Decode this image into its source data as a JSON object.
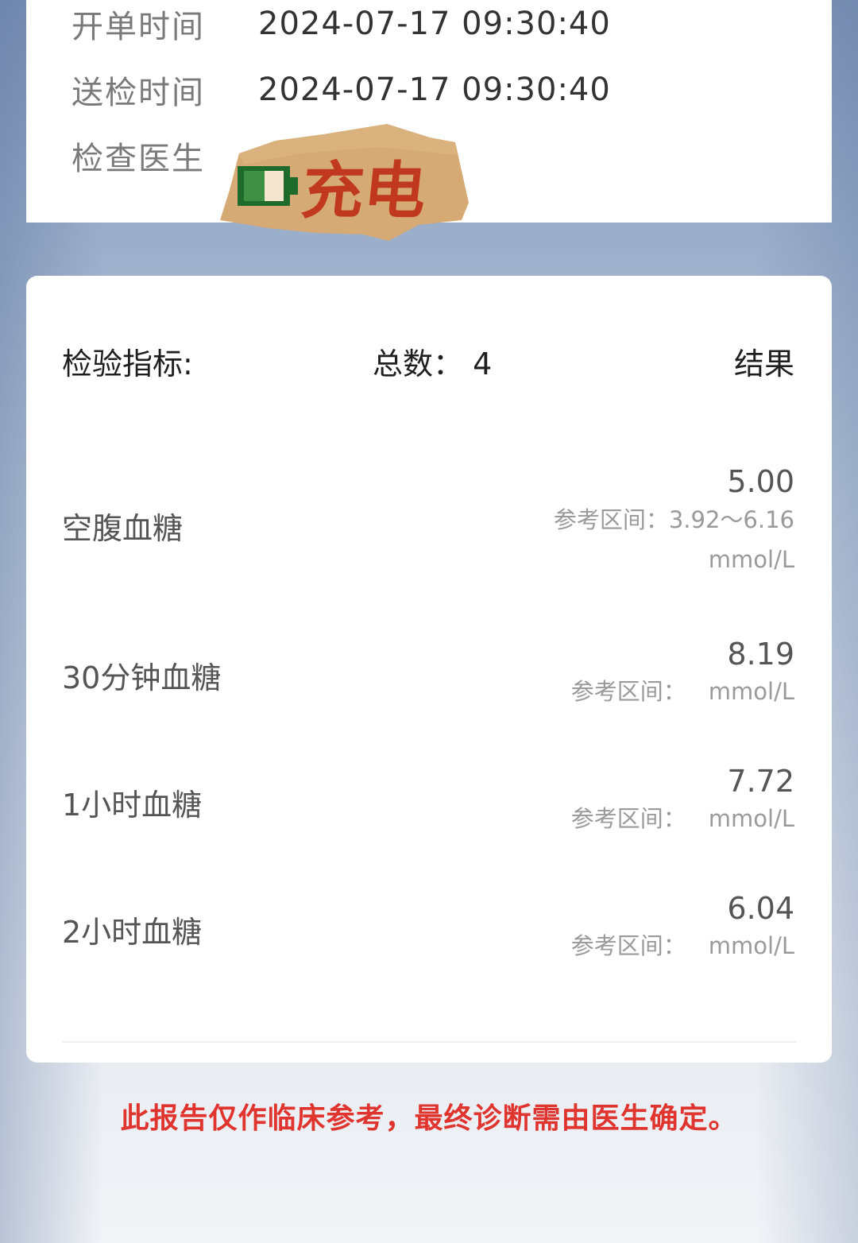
{
  "info": {
    "rows": [
      {
        "label": "开单时间",
        "value": "2024-07-17 09:30:40"
      },
      {
        "label": "送检时间",
        "value": "2024-07-17 09:30:40"
      },
      {
        "label": "检查医生",
        "value": ""
      }
    ],
    "sticker_text": "充电"
  },
  "results": {
    "header": {
      "label": "检验指标:",
      "count": "总数： 4",
      "result": "结果"
    },
    "items": [
      {
        "name": "空腹血糖",
        "value": "5.00",
        "ref_label": "参考区间：",
        "ref_range": "3.92～6.16",
        "unit": "mmol/L"
      },
      {
        "name": "30分钟血糖",
        "value": "8.19",
        "ref_label": "参考区间：",
        "ref_range": "",
        "unit": "mmol/L"
      },
      {
        "name": "1小时血糖",
        "value": "7.72",
        "ref_label": "参考区间：",
        "ref_range": "",
        "unit": "mmol/L"
      },
      {
        "name": "2小时血糖",
        "value": "6.04",
        "ref_label": "参考区间：",
        "ref_range": "",
        "unit": "mmol/L"
      }
    ]
  },
  "disclaimer": "此报告仅作临床参考，最终诊断需由医生确定。",
  "colors": {
    "disclaimer": "#e0342f",
    "sticker_bg": "#d6aa75",
    "sticker_text": "#c0391f",
    "sticker_battery": "#1f6b2b"
  }
}
